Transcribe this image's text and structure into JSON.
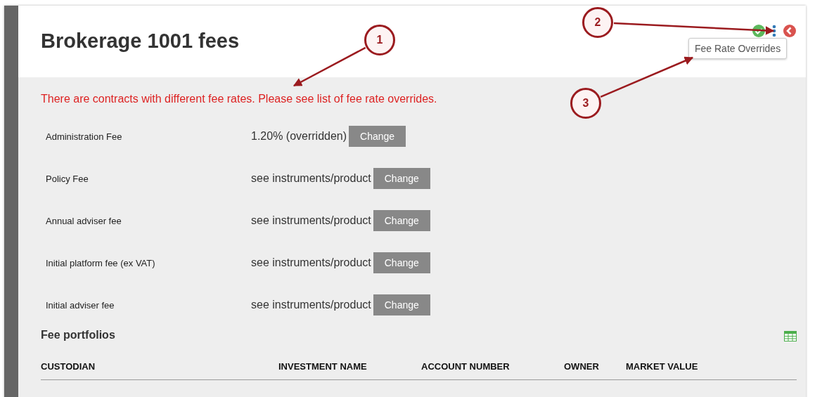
{
  "page": {
    "title": "Brokerage 1001 fees"
  },
  "tooltip": "Fee Rate Overrides",
  "warning": "There are contracts with different fee rates. Please see list of fee rate overrides.",
  "fees": [
    {
      "label": "Administration Fee",
      "value": "1.20% (overridden)",
      "button": "Change"
    },
    {
      "label": "Policy Fee",
      "value": "see instruments/product",
      "button": "Change"
    },
    {
      "label": "Annual adviser fee",
      "value": "see instruments/product",
      "button": "Change"
    },
    {
      "label": "Initial platform fee (ex VAT)",
      "value": "see instruments/product",
      "button": "Change"
    },
    {
      "label": "Initial adviser fee",
      "value": "see instruments/product",
      "button": "Change"
    }
  ],
  "portfolios": {
    "title": "Fee portfolios",
    "columns": [
      "CUSTODIAN",
      "INVESTMENT NAME",
      "ACCOUNT NUMBER",
      "OWNER",
      "MARKET VALUE"
    ]
  },
  "callouts": [
    "1",
    "2",
    "3"
  ]
}
